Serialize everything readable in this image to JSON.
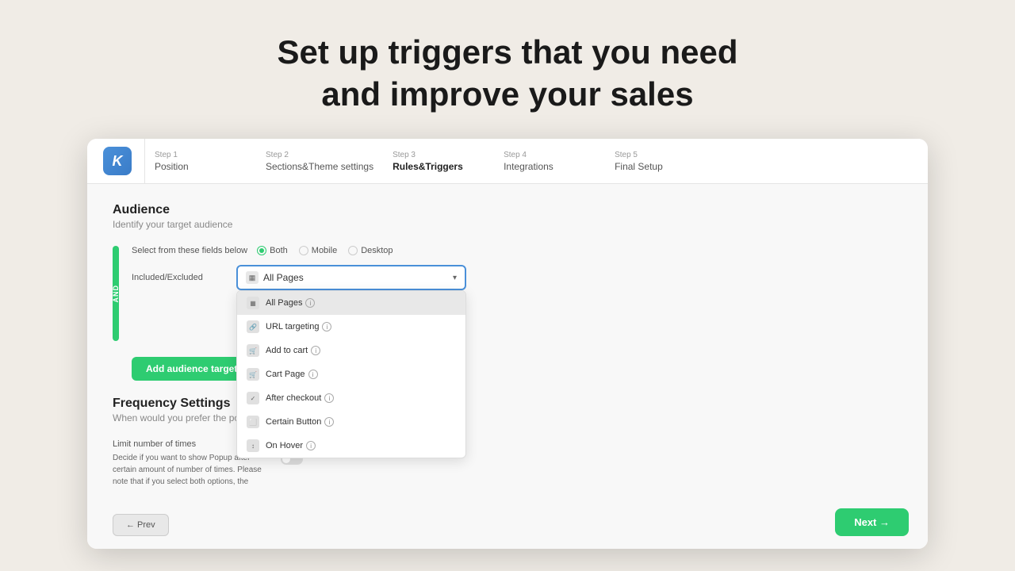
{
  "hero": {
    "line1": "Set up triggers that you need",
    "line2": "and improve your sales"
  },
  "steps": [
    {
      "label": "Step 1",
      "name": "Position",
      "active": false
    },
    {
      "label": "Step 2",
      "name": "Sections&Theme settings",
      "active": false
    },
    {
      "label": "Step 3",
      "name": "Rules&Triggers",
      "active": true
    },
    {
      "label": "Step 4",
      "name": "Integrations",
      "active": false
    },
    {
      "label": "Step 5",
      "name": "Final Setup",
      "active": false
    }
  ],
  "logo": {
    "letter": "K"
  },
  "audience": {
    "title": "Audience",
    "subtitle": "Identify your target audience",
    "device_label": "Select from these fields below",
    "device_options": [
      {
        "id": "both",
        "label": "Both",
        "checked": true
      },
      {
        "id": "mobile",
        "label": "Mobile",
        "checked": false
      },
      {
        "id": "desktop",
        "label": "Desktop",
        "checked": false
      }
    ],
    "included_label": "Included/Excluded",
    "dropdown_selected": "All Pages",
    "dropdown_options": [
      {
        "label": "All Pages",
        "info": true,
        "highlighted": true
      },
      {
        "label": "URL targeting",
        "info": true
      },
      {
        "label": "Add to cart",
        "info": true
      },
      {
        "label": "Cart Page",
        "info": true
      },
      {
        "label": "After checkout",
        "info": true
      },
      {
        "label": "Certain Button",
        "info": true
      },
      {
        "label": "On Hover",
        "info": true
      }
    ],
    "add_button_label": "Add audience targeting"
  },
  "frequency": {
    "title": "Frequency Settings",
    "subtitle": "When would you prefer the popup to be displayed?",
    "field_label": "Limit number of times",
    "field_description": "Decide if you want to show Popup after certain amount of number of times. Please note that if you select both options, the",
    "toggle_rows": [
      {
        "label": ""
      },
      {
        "label": ""
      }
    ]
  },
  "footer": {
    "back_label": "← Prev",
    "next_label": "Next →"
  }
}
